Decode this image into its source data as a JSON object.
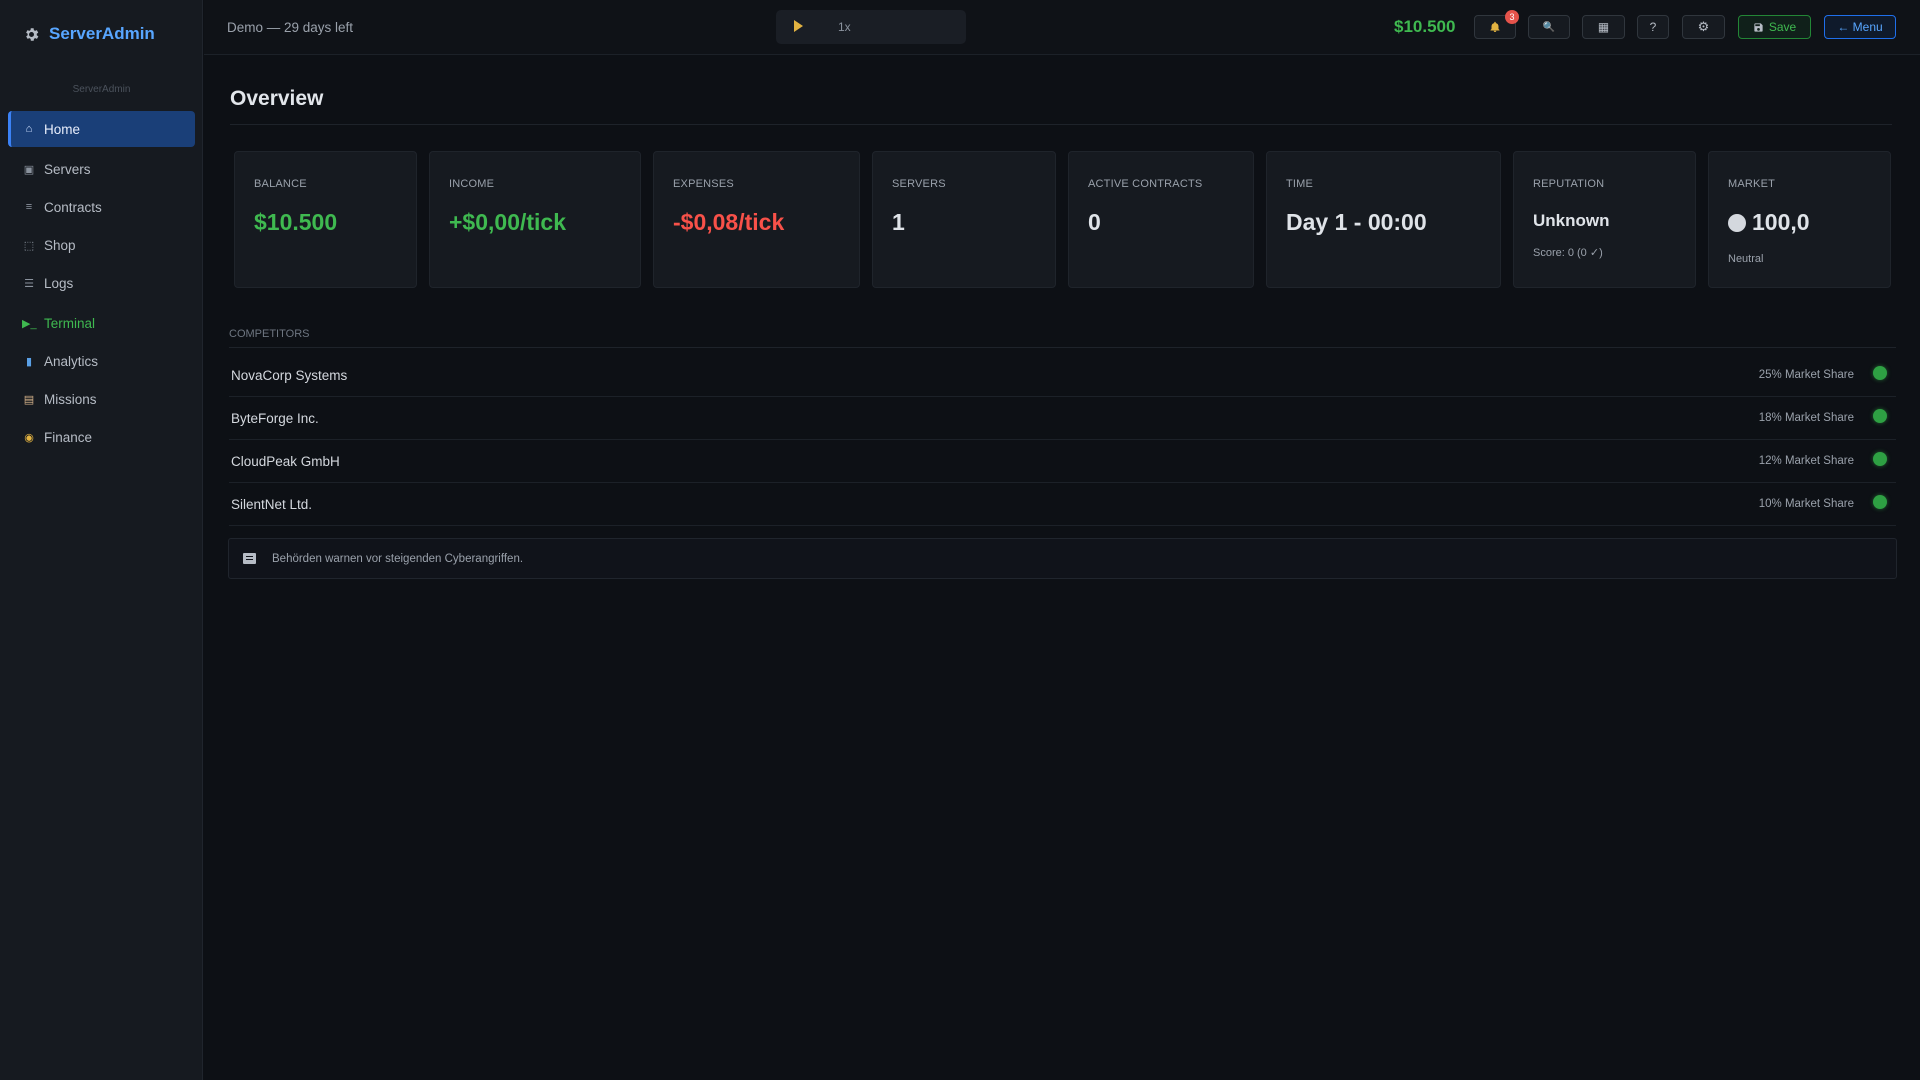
{
  "brand": {
    "name": "ServerAdmin",
    "subtitle": "ServerAdmin"
  },
  "sidebar": {
    "items": [
      {
        "icon": "⌂",
        "label": "Home"
      },
      {
        "icon": "▣",
        "label": "Servers"
      },
      {
        "icon": "≡",
        "label": "Contracts"
      },
      {
        "icon": "⬚",
        "label": "Shop"
      },
      {
        "icon": "☰",
        "label": "Logs"
      },
      {
        "icon": "▶_",
        "label": "Terminal"
      },
      {
        "icon": "▮",
        "label": "Analytics"
      },
      {
        "icon": "▤",
        "label": "Missions"
      },
      {
        "icon": "◉",
        "label": "Finance"
      }
    ]
  },
  "topbar": {
    "demo_text": "Demo — 29 days left",
    "speed": "1x",
    "balance": "$10.500",
    "notification_count": "3",
    "search_icon": "🔍",
    "grid_icon": "▦",
    "help_label": "?",
    "settings_icon": "⚙",
    "save_label": "Save",
    "menu_label": "← Menu"
  },
  "main": {
    "title": "Overview",
    "cards": {
      "balance": {
        "label": "Balance",
        "value": "$10.500"
      },
      "income": {
        "label": "Income",
        "value": "+$0,00/tick"
      },
      "expenses": {
        "label": "Expenses",
        "value": "-$0,08/tick"
      },
      "servers": {
        "label": "Servers",
        "value": "1"
      },
      "contracts": {
        "label": "Active Contracts",
        "value": "0"
      },
      "time": {
        "label": "Time",
        "value": "Day 1 - 00:00"
      },
      "reputation": {
        "label": "Reputation",
        "value": "Unknown",
        "sub": "Score: 0  (0 ✓)"
      },
      "market": {
        "label": "Market",
        "value": "100,0",
        "sub": "Neutral"
      }
    },
    "competitors_label": "Competitors",
    "competitors": [
      {
        "name": "NovaCorp Systems",
        "share": "25% Market Share"
      },
      {
        "name": "ByteForge Inc.",
        "share": "18% Market Share"
      },
      {
        "name": "CloudPeak GmbH",
        "share": "12% Market Share"
      },
      {
        "name": "SilentNet Ltd.",
        "share": "10% Market Share"
      }
    ],
    "news": "Behörden warnen vor steigenden Cyberangriffen."
  },
  "colors": {
    "accent": "#58a6ff",
    "positive": "#3fb950",
    "negative": "#f85149",
    "active_nav": "#1a3f78"
  }
}
